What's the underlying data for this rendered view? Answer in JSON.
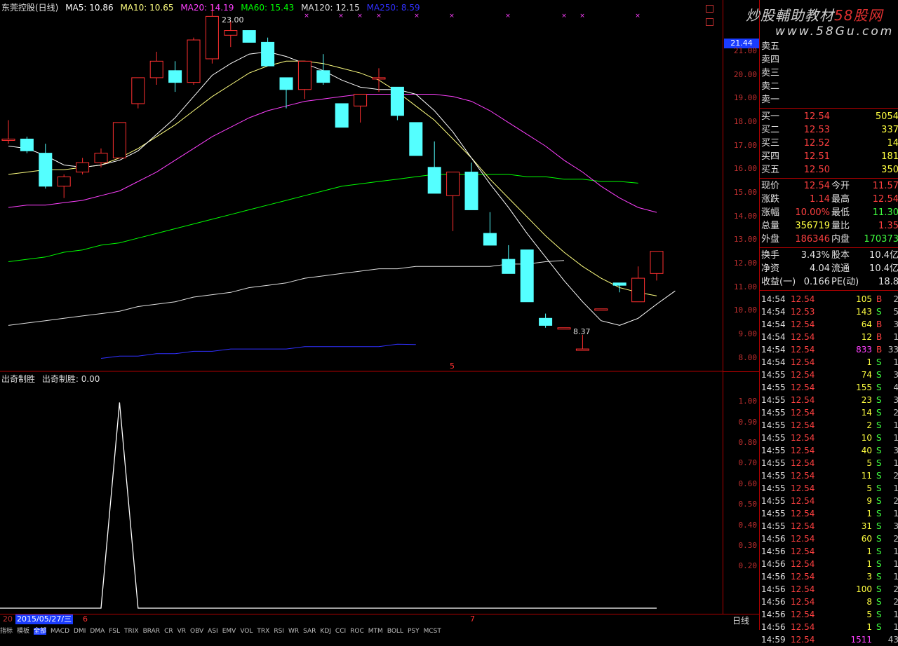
{
  "header": {
    "stock": "东莞控股(日线)",
    "ma5": "MA5: 10.86",
    "ma10": "MA10: 10.65",
    "ma20": "MA20: 14.19",
    "ma60": "MA60: 15.43",
    "ma120": "MA120: 12.15",
    "ma250": "MA250: 8.59"
  },
  "sub_header": {
    "name": "出奇制胜",
    "value": "出奇制胜: 0.00"
  },
  "annotations": {
    "high": "23.00",
    "low": "8.37",
    "marker": "5",
    "month_7": "7",
    "month_6": "6"
  },
  "price_axis": {
    "current": "21.44",
    "ticks": [
      "21.00",
      "20.00",
      "19.00",
      "18.00",
      "17.00",
      "16.00",
      "15.00",
      "14.00",
      "13.00",
      "12.00",
      "11.00",
      "10.00",
      "9.00",
      "8.00"
    ]
  },
  "sub_axis": {
    "ticks": [
      "1.00",
      "0.90",
      "0.80",
      "0.70",
      "0.60",
      "0.50",
      "0.40",
      "0.30",
      "0.20"
    ]
  },
  "logo": {
    "line1": "炒股輔助教材",
    "line1_b": "58股网",
    "line2": "www.58Gu.com"
  },
  "order_book": {
    "sell": [
      {
        "label": "卖五"
      },
      {
        "label": "卖四"
      },
      {
        "label": "卖三"
      },
      {
        "label": "卖二"
      },
      {
        "label": "卖一"
      }
    ],
    "buy": [
      {
        "label": "买一",
        "price": "12.54",
        "vol": "5054"
      },
      {
        "label": "买二",
        "price": "12.53",
        "vol": "337"
      },
      {
        "label": "买三",
        "price": "12.52",
        "vol": "14"
      },
      {
        "label": "买四",
        "price": "12.51",
        "vol": "181"
      },
      {
        "label": "买五",
        "price": "12.50",
        "vol": "350"
      }
    ]
  },
  "quote": [
    {
      "l1": "现价",
      "v1": "12.54",
      "l2": "今开",
      "v2": "11.57",
      "c1": "#ff4040",
      "c2": "#ff4040"
    },
    {
      "l1": "涨跌",
      "v1": "1.14",
      "l2": "最高",
      "v2": "12.54",
      "c1": "#ff4040",
      "c2": "#ff4040"
    },
    {
      "l1": "涨幅",
      "v1": "10.00%",
      "l2": "最低",
      "v2": "11.30",
      "c1": "#ff4040",
      "c2": "#40ff40"
    },
    {
      "l1": "总量",
      "v1": "356719",
      "l2": "量比",
      "v2": "1.35",
      "c1": "#ffff40",
      "c2": "#ff4040"
    },
    {
      "l1": "外盘",
      "v1": "186346",
      "l2": "内盘",
      "v2": "170373",
      "c1": "#ff4040",
      "c2": "#40ff40"
    }
  ],
  "stats": [
    {
      "l1": "换手",
      "v1": "3.43%",
      "l2": "股本",
      "v2": "10.4亿"
    },
    {
      "l1": "净资",
      "v1": "4.04",
      "l2": "流通",
      "v2": "10.4亿"
    },
    {
      "l1": "收益(一)",
      "v1": "0.166",
      "l2": "PE(动)",
      "v2": "18.8"
    }
  ],
  "trades": [
    {
      "t": "14:54",
      "p": "12.54",
      "v": "105",
      "bs": "B",
      "n": "2"
    },
    {
      "t": "14:54",
      "p": "12.53",
      "v": "143",
      "bs": "S",
      "n": "5"
    },
    {
      "t": "14:54",
      "p": "12.54",
      "v": "64",
      "bs": "B",
      "n": "3"
    },
    {
      "t": "14:54",
      "p": "12.54",
      "v": "12",
      "bs": "B",
      "n": "1"
    },
    {
      "t": "14:54",
      "p": "12.54",
      "v": "833",
      "bs": "B",
      "n": "33"
    },
    {
      "t": "14:54",
      "p": "12.54",
      "v": "1",
      "bs": "S",
      "n": "1"
    },
    {
      "t": "14:55",
      "p": "12.54",
      "v": "74",
      "bs": "S",
      "n": "3"
    },
    {
      "t": "14:55",
      "p": "12.54",
      "v": "155",
      "bs": "S",
      "n": "4"
    },
    {
      "t": "14:55",
      "p": "12.54",
      "v": "23",
      "bs": "S",
      "n": "3"
    },
    {
      "t": "14:55",
      "p": "12.54",
      "v": "14",
      "bs": "S",
      "n": "2"
    },
    {
      "t": "14:55",
      "p": "12.54",
      "v": "2",
      "bs": "S",
      "n": "1"
    },
    {
      "t": "14:55",
      "p": "12.54",
      "v": "10",
      "bs": "S",
      "n": "1"
    },
    {
      "t": "14:55",
      "p": "12.54",
      "v": "40",
      "bs": "S",
      "n": "3"
    },
    {
      "t": "14:55",
      "p": "12.54",
      "v": "5",
      "bs": "S",
      "n": "1"
    },
    {
      "t": "14:55",
      "p": "12.54",
      "v": "11",
      "bs": "S",
      "n": "2"
    },
    {
      "t": "14:55",
      "p": "12.54",
      "v": "5",
      "bs": "S",
      "n": "1"
    },
    {
      "t": "14:55",
      "p": "12.54",
      "v": "9",
      "bs": "S",
      "n": "2"
    },
    {
      "t": "14:55",
      "p": "12.54",
      "v": "1",
      "bs": "S",
      "n": "1"
    },
    {
      "t": "14:55",
      "p": "12.54",
      "v": "31",
      "bs": "S",
      "n": "3"
    },
    {
      "t": "14:56",
      "p": "12.54",
      "v": "60",
      "bs": "S",
      "n": "2"
    },
    {
      "t": "14:56",
      "p": "12.54",
      "v": "1",
      "bs": "S",
      "n": "1"
    },
    {
      "t": "14:56",
      "p": "12.54",
      "v": "1",
      "bs": "S",
      "n": "1"
    },
    {
      "t": "14:56",
      "p": "12.54",
      "v": "3",
      "bs": "S",
      "n": "1"
    },
    {
      "t": "14:56",
      "p": "12.54",
      "v": "100",
      "bs": "S",
      "n": "2"
    },
    {
      "t": "14:56",
      "p": "12.54",
      "v": "8",
      "bs": "S",
      "n": "2"
    },
    {
      "t": "14:56",
      "p": "12.54",
      "v": "5",
      "bs": "S",
      "n": "1"
    },
    {
      "t": "14:56",
      "p": "12.54",
      "v": "1",
      "bs": "S",
      "n": "1"
    },
    {
      "t": "14:59",
      "p": "12.54",
      "v": "1511",
      "bs": "",
      "n": "43"
    }
  ],
  "bottom": {
    "prefix": "20",
    "date": "2015/05/27/三",
    "period": "日线",
    "tabs": [
      "指标",
      "模板",
      "全部",
      "MACD",
      "DMI",
      "DMA",
      "FSL",
      "TRIX",
      "BRAR",
      "CR",
      "VR",
      "OBV",
      "ASI",
      "EMV",
      "VOL",
      "TRX",
      "RSI",
      "WR",
      "SAR",
      "KDJ",
      "CCI",
      "ROC",
      "MTM",
      "BOLL",
      "PSY",
      "MCST"
    ]
  },
  "colors": {
    "up": "#ff3030",
    "down": "#54ffff",
    "ma5": "#ffffff",
    "ma10": "#ffff80",
    "ma20": "#ff40ff",
    "ma60": "#00ff00",
    "ma120": "#e0e0e0",
    "ma250": "#3030ff",
    "axis": "#b00000"
  },
  "chart_data": {
    "type": "candlestick",
    "candles": [
      {
        "o": 17.3,
        "h": 18.1,
        "l": 17.1,
        "c": 17.3
      },
      {
        "o": 17.3,
        "h": 17.4,
        "l": 16.7,
        "c": 16.8
      },
      {
        "o": 16.7,
        "h": 17.1,
        "l": 15.2,
        "c": 15.3
      },
      {
        "o": 15.3,
        "h": 15.8,
        "l": 14.8,
        "c": 15.7
      },
      {
        "o": 15.9,
        "h": 16.5,
        "l": 15.8,
        "c": 16.3
      },
      {
        "o": 16.3,
        "h": 16.9,
        "l": 16.1,
        "c": 16.7
      },
      {
        "o": 16.5,
        "h": 18.0,
        "l": 16.5,
        "c": 18.0
      },
      {
        "o": 18.8,
        "h": 19.6,
        "l": 18.6,
        "c": 19.9
      },
      {
        "o": 19.9,
        "h": 21.0,
        "l": 19.6,
        "c": 20.6
      },
      {
        "o": 20.2,
        "h": 20.6,
        "l": 19.3,
        "c": 19.7
      },
      {
        "o": 19.7,
        "h": 21.6,
        "l": 19.6,
        "c": 21.5
      },
      {
        "o": 20.7,
        "h": 23.0,
        "l": 20.5,
        "c": 22.5
      },
      {
        "o": 21.7,
        "h": 22.3,
        "l": 21.2,
        "c": 21.9
      },
      {
        "o": 21.9,
        "h": 21.9,
        "l": 21.4,
        "c": 21.4
      },
      {
        "o": 21.4,
        "h": 21.6,
        "l": 20.4,
        "c": 20.4
      },
      {
        "o": 19.9,
        "h": 19.9,
        "l": 18.6,
        "c": 19.4
      },
      {
        "o": 19.4,
        "h": 20.6,
        "l": 19.0,
        "c": 20.6
      },
      {
        "o": 20.2,
        "h": 20.9,
        "l": 19.6,
        "c": 19.7
      },
      {
        "o": 18.8,
        "h": 18.8,
        "l": 17.8,
        "c": 17.8
      },
      {
        "o": 18.7,
        "h": 19.2,
        "l": 18.0,
        "c": 19.2
      },
      {
        "o": 19.9,
        "h": 20.3,
        "l": 19.3,
        "c": 19.9
      },
      {
        "o": 19.5,
        "h": 19.5,
        "l": 18.1,
        "c": 18.3
      },
      {
        "o": 18.0,
        "h": 18.0,
        "l": 16.6,
        "c": 16.6
      },
      {
        "o": 16.1,
        "h": 17.2,
        "l": 15.0,
        "c": 15.0
      },
      {
        "o": 14.9,
        "h": 15.9,
        "l": 13.4,
        "c": 15.9
      },
      {
        "o": 15.9,
        "h": 16.3,
        "l": 14.3,
        "c": 14.3
      },
      {
        "o": 13.3,
        "h": 14.2,
        "l": 12.8,
        "c": 12.8
      },
      {
        "o": 12.2,
        "h": 12.8,
        "l": 11.6,
        "c": 11.6
      },
      {
        "o": 12.6,
        "h": 12.6,
        "l": 10.4,
        "c": 10.4
      },
      {
        "o": 9.7,
        "h": 9.9,
        "l": 9.3,
        "c": 9.4
      },
      {
        "o": 9.3,
        "h": 9.3,
        "l": 9.3,
        "c": 9.3
      },
      {
        "o": 8.4,
        "h": 9.0,
        "l": 8.37,
        "c": 8.4
      },
      {
        "o": 10.1,
        "h": 10.1,
        "l": 10.1,
        "c": 10.1
      },
      {
        "o": 11.2,
        "h": 11.2,
        "l": 10.8,
        "c": 11.1
      },
      {
        "o": 10.4,
        "h": 11.9,
        "l": 10.4,
        "c": 11.4
      },
      {
        "o": 11.6,
        "h": 12.54,
        "l": 11.3,
        "c": 12.54
      }
    ],
    "ma5": [
      17.0,
      16.9,
      16.6,
      16.2,
      16.1,
      16.2,
      16.4,
      16.8,
      17.5,
      18.2,
      19.1,
      20.0,
      20.5,
      20.9,
      21.0,
      20.8,
      20.5,
      20.2,
      19.8,
      19.5,
      19.4,
      19.4,
      19.2,
      18.5,
      17.6,
      16.5,
      15.4,
      14.4,
      13.3,
      12.3,
      11.3,
      10.4,
      9.6,
      9.4,
      9.7,
      10.3,
      10.86
    ],
    "ma10": [
      15.8,
      15.9,
      16.0,
      16.0,
      16.1,
      16.2,
      16.5,
      16.9,
      17.4,
      17.9,
      18.5,
      19.1,
      19.6,
      20.1,
      20.4,
      20.6,
      20.6,
      20.5,
      20.3,
      20.1,
      19.8,
      19.3,
      18.7,
      18.1,
      17.3,
      16.5,
      15.6,
      14.8,
      14.0,
      13.2,
      12.5,
      11.9,
      11.4,
      11.0,
      10.8,
      10.65
    ],
    "ma20": [
      14.4,
      14.5,
      14.5,
      14.6,
      14.7,
      14.9,
      15.1,
      15.5,
      15.9,
      16.4,
      16.9,
      17.4,
      17.8,
      18.2,
      18.5,
      18.7,
      18.9,
      19.0,
      19.1,
      19.2,
      19.2,
      19.2,
      19.2,
      19.2,
      19.1,
      18.9,
      18.5,
      18.0,
      17.5,
      17.0,
      16.4,
      15.9,
      15.3,
      14.8,
      14.4,
      14.19
    ],
    "ma60": [
      12.1,
      12.2,
      12.3,
      12.5,
      12.6,
      12.8,
      12.9,
      13.1,
      13.3,
      13.5,
      13.7,
      13.9,
      14.1,
      14.3,
      14.5,
      14.7,
      14.9,
      15.1,
      15.3,
      15.4,
      15.5,
      15.6,
      15.7,
      15.8,
      15.8,
      15.8,
      15.8,
      15.8,
      15.7,
      15.7,
      15.6,
      15.6,
      15.5,
      15.5,
      15.43
    ],
    "ma120": [
      9.4,
      9.5,
      9.6,
      9.7,
      9.8,
      9.9,
      10.0,
      10.2,
      10.3,
      10.4,
      10.6,
      10.7,
      10.8,
      11.0,
      11.1,
      11.2,
      11.4,
      11.5,
      11.6,
      11.7,
      11.8,
      11.8,
      11.9,
      11.9,
      11.9,
      11.9,
      11.9,
      12.0,
      12.0,
      12.1,
      12.15
    ],
    "ma250": [
      8.0,
      8.1,
      8.1,
      8.2,
      8.2,
      8.3,
      8.3,
      8.4,
      8.4,
      8.4,
      8.4,
      8.5,
      8.5,
      8.5,
      8.5,
      8.5,
      8.6,
      8.59
    ],
    "price_range": [
      7.6,
      22.6
    ],
    "indicator": {
      "name": "出奇制胜",
      "values": [
        0,
        0,
        0,
        0,
        0,
        0,
        1,
        0,
        0,
        0,
        0,
        0,
        0,
        0,
        0,
        0,
        0,
        0,
        0,
        0,
        0,
        0,
        0,
        0,
        0,
        0,
        0,
        0,
        0,
        0,
        0,
        0,
        0,
        0,
        0,
        0
      ],
      "range": [
        0.0,
        1.1
      ]
    }
  }
}
